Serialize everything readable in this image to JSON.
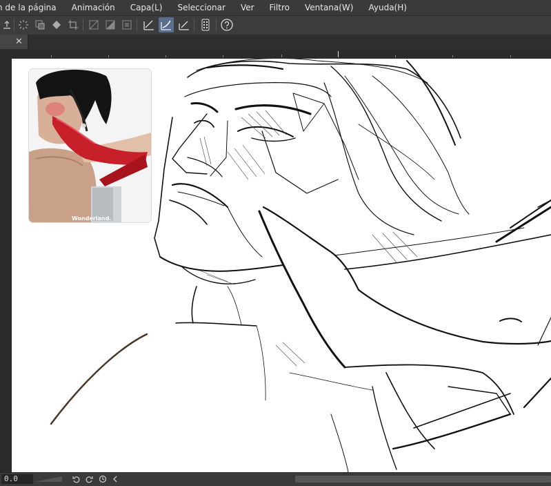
{
  "menu": {
    "items": [
      {
        "label": "n de la página"
      },
      {
        "label": "Animación"
      },
      {
        "label": "Capa(L)"
      },
      {
        "label": "Seleccionar"
      },
      {
        "label": "Ver"
      },
      {
        "label": "Filtro"
      },
      {
        "label": "Ventana(W)"
      },
      {
        "label": "Ayuda(H)"
      }
    ]
  },
  "toolbar": {
    "icons": [
      "export-icon",
      "spinner-icon",
      "transform-icon",
      "fill-icon",
      "crop-icon",
      "layer-mask-icon",
      "tone-icon",
      "frame-icon",
      "pen-stabilizer-icon",
      "stroke-tool-icon",
      "ruler-pen-icon",
      "device-icon",
      "help-icon"
    ],
    "active": "stroke-tool-icon"
  },
  "tabs": {
    "close_glyph": "✕"
  },
  "reference": {
    "caption": "Wonderland."
  },
  "status": {
    "zoom_value": "0.0"
  },
  "colors": {
    "ui_dark": "#2d2d2d",
    "menubar": "#3a3a3a",
    "toolbar": "#3c3c3c",
    "active_tool": "#5a6f8e",
    "canvas": "#ffffff",
    "shoe_red": "#c8202a"
  }
}
